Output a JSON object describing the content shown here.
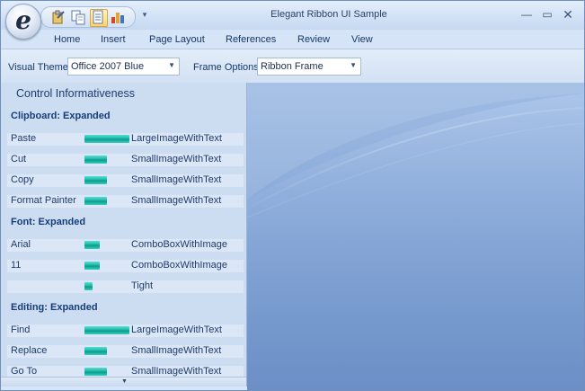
{
  "app": {
    "title": "Elegant Ribbon UI Sample",
    "orb_glyph": "e"
  },
  "quick_access": {
    "buttons": [
      "paste-icon",
      "copy-icon",
      "document-icon",
      "chart-icon"
    ],
    "dropdown_glyph": "▾"
  },
  "window_controls": {
    "minimize": "—",
    "maximize": "▭",
    "close": "✕"
  },
  "tabs": [
    "Home",
    "Insert",
    "Page Layout",
    "References",
    "Review",
    "View"
  ],
  "options": {
    "visual_theme_label": "Visual Theme",
    "visual_theme_value": "Office 2007 Blue",
    "frame_options_label": "Frame Options",
    "frame_options_value": "Ribbon Frame"
  },
  "panel": {
    "title": "Control Informativeness",
    "groups": [
      {
        "header": "Clipboard: Expanded",
        "rows": [
          {
            "name": "Paste",
            "kind": "LargeImageWithText",
            "level": 1.0
          },
          {
            "name": "Cut",
            "kind": "SmallImageWithText",
            "level": 0.5
          },
          {
            "name": "Copy",
            "kind": "SmallImageWithText",
            "level": 0.5
          },
          {
            "name": "Format Painter",
            "kind": "SmallImageWithText",
            "level": 0.5
          }
        ]
      },
      {
        "header": "Font: Expanded",
        "rows": [
          {
            "name": "Arial",
            "kind": "ComboBoxWithImage",
            "level": 0.33
          },
          {
            "name": "11",
            "kind": "ComboBoxWithImage",
            "level": 0.33
          },
          {
            "name": "",
            "kind": "Tight",
            "level": 0.17
          }
        ]
      },
      {
        "header": "Editing: Expanded",
        "rows": [
          {
            "name": "Find",
            "kind": "LargeImageWithText",
            "level": 1.0
          },
          {
            "name": "Replace",
            "kind": "SmallImageWithText",
            "level": 0.5
          },
          {
            "name": "Go To",
            "kind": "SmallImageWithText",
            "level": 0.5
          }
        ]
      }
    ]
  },
  "colors": {
    "accent": "#1fb7a6",
    "frame": "#d7e5f6",
    "content_top": "#9fbce3",
    "content_bottom": "#6b8fc6"
  }
}
